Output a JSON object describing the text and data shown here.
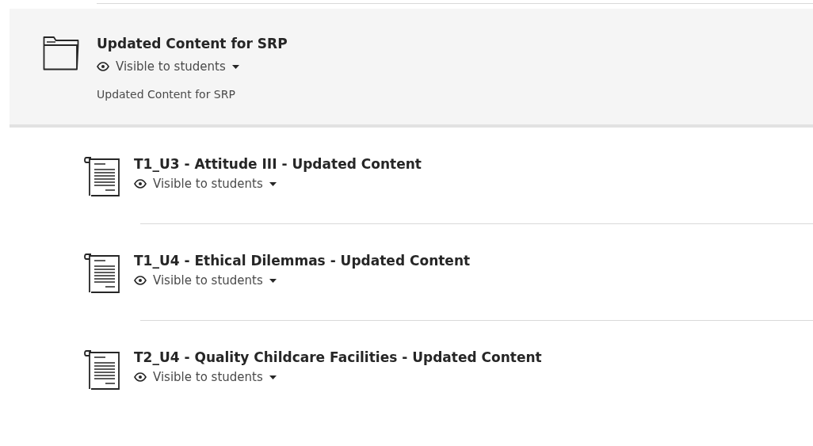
{
  "folder": {
    "title": "Updated Content for SRP",
    "visibility": "Visible to students",
    "description": "Updated Content for SRP"
  },
  "items": [
    {
      "title": "T1_U3 - Attitude III - Updated Content",
      "visibility": "Visible to students"
    },
    {
      "title": "T1_U4 - Ethical Dilemmas - Updated Content",
      "visibility": "Visible to students"
    },
    {
      "title": "T2_U4 - Quality Childcare Facilities - Updated Content",
      "visibility": "Visible to students"
    }
  ]
}
